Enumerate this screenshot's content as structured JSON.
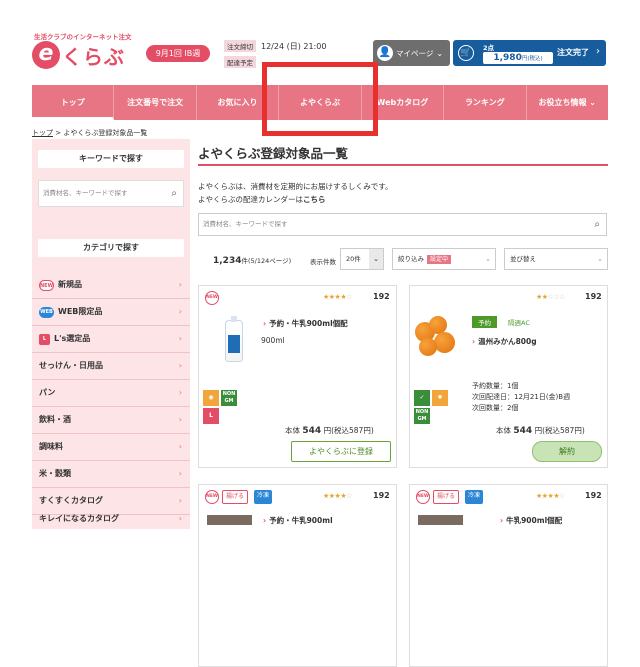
{
  "header": {
    "tagline": "生活クラブのインターネット注文",
    "logo_text": "くらぶ",
    "week_label": "9月1回 IB週",
    "deadline_label": "注文締切",
    "deadline_value": "12/24 (日) 21:00",
    "delivery_label": "配達予定",
    "mypage_label": "マイページ",
    "cart_count": "2点",
    "cart_amount": "1,980",
    "cart_tax_note": "円(税込)",
    "order_complete_label": "注文完了"
  },
  "nav": {
    "items": [
      {
        "label": "トップ",
        "active": true
      },
      {
        "label": "注文番号で注文"
      },
      {
        "label": "お気に入り"
      },
      {
        "label": "よやくらぶ"
      },
      {
        "label": "Webカタログ"
      },
      {
        "label": "ランキング"
      },
      {
        "label": "お役立ち情報 ⌄"
      }
    ]
  },
  "breadcrumb": {
    "home": "トップ",
    "sep": " > ",
    "current": "よやくらぶ登録対象品一覧"
  },
  "sidebar": {
    "keyword_title": "キーワードで探す",
    "keyword_placeholder": "消費材名、キーワードで探す",
    "category_title": "カテゴリで探す",
    "categories": [
      {
        "label": "新規品",
        "badge": "NEW",
        "badge_color": "#ffffff"
      },
      {
        "label": "WEB限定品",
        "badge": "WEB",
        "badge_color": "#2b86d6"
      },
      {
        "label": "L's選定品",
        "badge": "L",
        "badge_color": "#e34d66"
      },
      {
        "label": "せっけん・日用品"
      },
      {
        "label": "パン"
      },
      {
        "label": "飲料・酒"
      },
      {
        "label": "調味料"
      },
      {
        "label": "米・穀類"
      },
      {
        "label": "すくすくカタログ"
      },
      {
        "label": "キレイになるカタログ"
      }
    ]
  },
  "main": {
    "title": "よやくらぶ登録対象品一覧",
    "desc_line1": "よやくらぶは、消費材を定期的にお届けするしくみです。",
    "desc_line2_prefix": "よやくらぶの配達カレンダーは",
    "desc_line2_link": "こちら",
    "search_placeholder": "消費材名、キーワードで探す",
    "result_count": "1,234",
    "result_unit": "件(5/124ページ)",
    "display_label": "表示件数",
    "display_value": "20件",
    "filter_label": "絞り込み",
    "filter_tag": "設定中",
    "sort_label": "並び替え"
  },
  "products": [
    {
      "badge": "NEW",
      "stars": "★★★★",
      "stars_empty": "☆",
      "reviews": "192",
      "name": "予約・牛乳900ml個配",
      "volume": "900ml",
      "price_prefix": "本体",
      "price": "544",
      "price_tax": "円(税込587円)",
      "button": "よやくらぶに登録"
    },
    {
      "badge": "",
      "stars": "★★",
      "stars_empty": "☆☆☆",
      "reviews": "192",
      "tag_green": "予約",
      "tag_text": "隔週AC",
      "name": "温州みかん800g",
      "info1": "予約数量：1個",
      "info2": "次回配達日：12月21日(金)B週",
      "info3": "次回数量：2個",
      "price_prefix": "本体",
      "price": "544",
      "price_tax": "円(税込587円)",
      "button": "解約"
    },
    {
      "badge": "NEW",
      "tag1": "揚げる",
      "tag2": "冷凍",
      "stars": "★★★★",
      "stars_empty": "☆",
      "reviews": "192",
      "name": "予約・牛乳900ml"
    },
    {
      "badge": "NEW",
      "tag1": "揚げる",
      "tag2": "冷凍",
      "stars": "★★★★",
      "stars_empty": "☆",
      "reviews": "192",
      "name": "牛乳900ml個配"
    }
  ]
}
